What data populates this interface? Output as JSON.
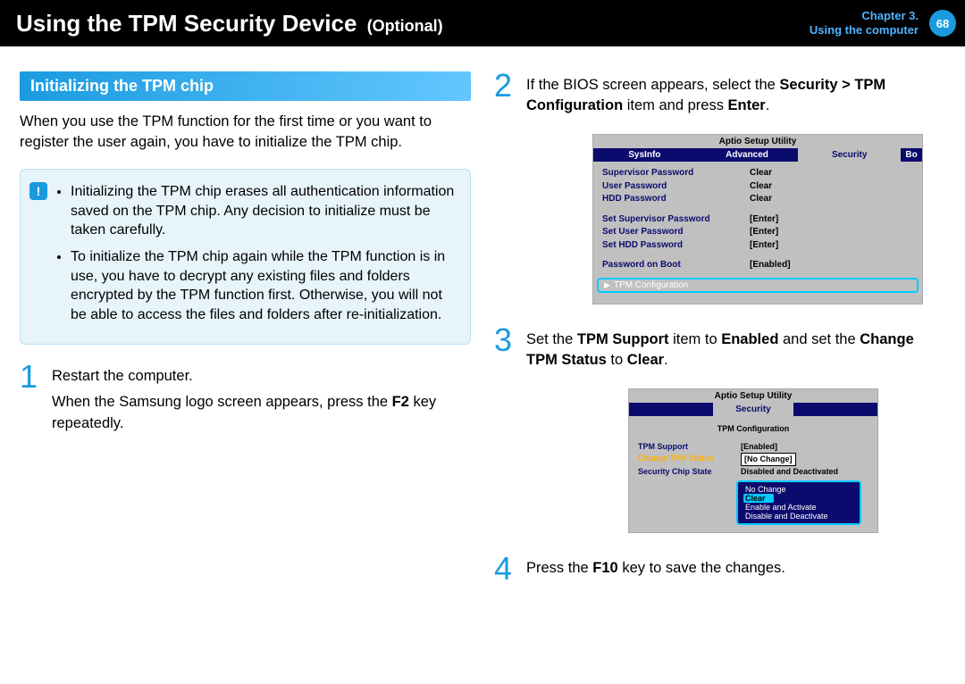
{
  "header": {
    "title": "Using the TPM Security Device",
    "optional": "(Optional)",
    "chapter": "Chapter 3.",
    "subtitle": "Using the computer",
    "page": "68"
  },
  "section": {
    "heading": "Initializing the TPM chip",
    "intro": "When you use the TPM function for the first time or you want to register the user again, you have to initialize the TPM chip."
  },
  "callout": {
    "icon": "!",
    "items": [
      "Initializing the TPM chip erases all authentication information saved on the TPM chip. Any decision to initialize must be taken carefully.",
      "To initialize the TPM chip again while the TPM function is in use, you have to decrypt any existing files and folders encrypted by the TPM function first. Otherwise, you will not be able to access the files and folders after re-initialization."
    ]
  },
  "steps": {
    "s1": {
      "num": "1",
      "line1": "Restart the computer.",
      "line2a": "When the Samsung logo screen appears, press the ",
      "line2b": "F2",
      "line2c": " key repeatedly."
    },
    "s2": {
      "num": "2",
      "lineA": "If the BIOS screen appears, select the ",
      "lineB": "Security > TPM Configuration",
      "lineC": " item and press ",
      "lineD": "Enter",
      "lineE": "."
    },
    "s3": {
      "num": "3",
      "a": "Set the ",
      "b": "TPM Support",
      "c": " item to ",
      "d": "Enabled",
      "e": " and set the ",
      "f": "Change TPM Status",
      "g": " to ",
      "h": "Clear",
      "i": "."
    },
    "s4": {
      "num": "4",
      "a": "Press the ",
      "b": "F10",
      "c": " key to save the changes."
    }
  },
  "bios1": {
    "title": "Aptio Setup Utility",
    "tabs": [
      "SysInfo",
      "Advanced",
      "Security",
      "Bo"
    ],
    "rows1": [
      {
        "lab": "Supervisor Password",
        "val": "Clear"
      },
      {
        "lab": "User Password",
        "val": "Clear"
      },
      {
        "lab": "HDD Password",
        "val": "Clear"
      }
    ],
    "rows2": [
      {
        "lab": "Set Supervisor Password",
        "val": "[Enter]"
      },
      {
        "lab": "Set User Password",
        "val": "[Enter]"
      },
      {
        "lab": "Set HDD Password",
        "val": "[Enter]"
      }
    ],
    "row3": {
      "lab": "Password on Boot",
      "val": "[Enabled]"
    },
    "sel": "TPM Configuration"
  },
  "bios2": {
    "title": "Aptio Setup Utility",
    "tab": "Security",
    "sub": "TPM Configuration",
    "rows": [
      {
        "lab": "TPM Support",
        "val": "[Enabled]",
        "hl": false,
        "box": false
      },
      {
        "lab": "Change TPM Status",
        "val": "[No Change]",
        "hl": true,
        "box": true
      },
      {
        "lab": "Security Chip State",
        "val": "Disabled and Deactivated",
        "hl": false,
        "box": false
      }
    ],
    "popup": [
      "No Change",
      "Clear",
      "Enable and Activate",
      "Disable and Deactivate"
    ],
    "popup_sel": "Clear"
  }
}
